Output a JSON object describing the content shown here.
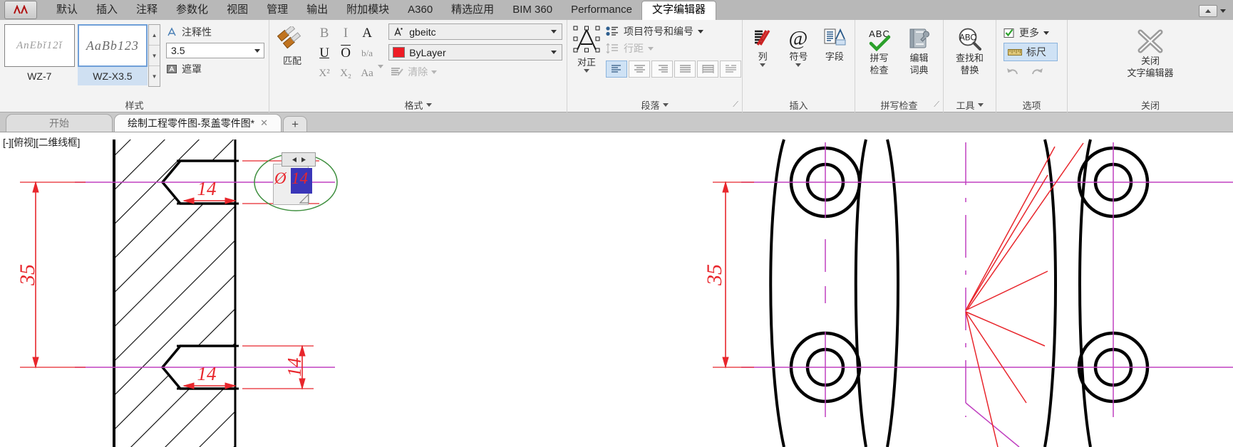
{
  "app": {
    "app_button_label": "A",
    "minimize_ribbon_icon": "triangle-up-icon",
    "minimize_ribbon_caret": "chevron-down-icon"
  },
  "ribbon_tabs": [
    {
      "label": "默认",
      "active": false
    },
    {
      "label": "插入",
      "active": false
    },
    {
      "label": "注释",
      "active": false
    },
    {
      "label": "参数化",
      "active": false
    },
    {
      "label": "视图",
      "active": false
    },
    {
      "label": "管理",
      "active": false
    },
    {
      "label": "输出",
      "active": false
    },
    {
      "label": "附加模块",
      "active": false
    },
    {
      "label": "A360",
      "active": false
    },
    {
      "label": "精选应用",
      "active": false
    },
    {
      "label": "BIM 360",
      "active": false
    },
    {
      "label": "Performance",
      "active": false
    },
    {
      "label": "文字编辑器",
      "active": true
    }
  ],
  "panels": {
    "style": {
      "title": "样式",
      "gallery": [
        {
          "sample": "AnEbĭ12ǐ",
          "name": "WZ-7",
          "selected": false
        },
        {
          "sample": "AaBb123",
          "name": "WZ-X3.5",
          "selected": true
        }
      ],
      "scroll_up_icon": "scroll-up-icon",
      "scroll_down_icon": "scroll-down-icon",
      "scroll_more_icon": "gallery-expand-icon",
      "annotative_label": "注释性",
      "annotative_icon": "annotative-icon",
      "height_value": "3.5",
      "height_dropdown_icon": "chevron-down-icon",
      "mask_label": "遮罩",
      "mask_icon": "mask-icon"
    },
    "format": {
      "title": "格式",
      "title_dropdown_icon": "chevron-down-icon",
      "match_label": "匹配",
      "match_icon": "format-painter-icon",
      "bold_label": "B",
      "italic_label": "I",
      "stack_label": "A",
      "underline_label": "U",
      "overline_label": "O",
      "oblique_label": "b/a",
      "superscript_label": "X²",
      "subscript_label": "X₂",
      "case_label": "Aa",
      "case_dropdown_icon": "chevron-down-icon",
      "font_value": "gbeitc",
      "font_icon": "font-icon",
      "font_dropdown_icon": "chevron-down-icon",
      "color_value": "ByLayer",
      "color_swatch": "#ee1c25",
      "color_dropdown_icon": "chevron-down-icon",
      "clear_label": "清除",
      "clear_icon": "clear-formatting-icon",
      "clear_dropdown_icon": "chevron-down-icon"
    },
    "paragraph": {
      "title": "段落",
      "title_dropdown_icon": "chevron-down-icon",
      "dialog_launcher_icon": "dialog-launcher-icon",
      "justify_label": "对正",
      "justify_icon": "justify-icon",
      "bullets_label": "项目符号和编号",
      "bullets_icon": "bullets-icon",
      "bullets_dropdown_icon": "chevron-down-icon",
      "linespacing_label": "行距",
      "linespacing_icon": "line-spacing-icon",
      "linespacing_dropdown_icon": "chevron-down-icon",
      "align_buttons": [
        {
          "name": "align-left",
          "selected": true
        },
        {
          "name": "align-center",
          "selected": false
        },
        {
          "name": "align-right",
          "selected": false
        },
        {
          "name": "align-justify",
          "selected": false
        },
        {
          "name": "align-distributed",
          "selected": false
        },
        {
          "name": "paragraph-settings",
          "selected": false
        }
      ]
    },
    "insert": {
      "title": "插入",
      "columns_label": "列",
      "columns_icon": "columns-icon",
      "columns_dropdown_icon": "chevron-down-icon",
      "symbol_label": "符号",
      "symbol_icon": "at-symbol-icon",
      "symbol_dropdown_icon": "chevron-down-icon",
      "field_label": "字段",
      "field_icon": "field-icon"
    },
    "spellcheck": {
      "title": "拼写检查",
      "dialog_launcher_icon": "dialog-launcher-icon",
      "check_label": "拼写\n检查",
      "check_label_line1": "拼写",
      "check_label_line2": "检查",
      "check_icon": "abc-check-icon",
      "dictionary_label_line1": "编辑",
      "dictionary_label_line2": "词典",
      "dictionary_icon": "dictionary-icon"
    },
    "tools": {
      "title": "工具",
      "title_dropdown_icon": "chevron-down-icon",
      "findreplace_label_line1": "查找和",
      "findreplace_label_line2": "替换",
      "findreplace_icon": "find-replace-icon"
    },
    "options": {
      "title": "选项",
      "more_label": "更多",
      "more_icon": "checkbox-checked-icon",
      "more_dropdown_icon": "chevron-down-icon",
      "ruler_label": "标尺",
      "ruler_icon": "ruler-icon",
      "ruler_selected": true,
      "undo_icon": "undo-icon",
      "redo_icon": "redo-icon"
    },
    "close": {
      "title": "关闭",
      "close_label_line1": "关闭",
      "close_label_line2": "文字编辑器",
      "close_icon": "close-x-icon"
    }
  },
  "document_tabs": [
    {
      "label": "开始",
      "active": false,
      "closable": false
    },
    {
      "label": "绘制工程零件图-泵盖零件图*",
      "active": true,
      "closable": true,
      "close_icon": "close-icon"
    }
  ],
  "new_tab_button": {
    "label": "+",
    "icon": "plus-icon"
  },
  "canvas": {
    "viewport_label": "[-][俯视][二维线框]",
    "dimensions": {
      "left_vertical": "35",
      "left_upper_horizontal": "14",
      "left_lower_horizontal": "14",
      "left_lower_vertical": "14",
      "right_vertical": "35"
    },
    "inplace_editor": {
      "text": "Ø14",
      "prefix": "Ø",
      "selected_text": "14",
      "selection_color": "#3a36b8",
      "text_color": "#e8262c",
      "toolbar_left_arrow_icon": "arrow-left-icon",
      "toolbar_right_arrow_icon": "arrow-right-icon",
      "highlight_ellipse_color": "#3f8f3f"
    },
    "colors": {
      "dimension_red": "#e8262c",
      "centerline_magenta": "#c040c0",
      "object_black": "#000000"
    }
  }
}
